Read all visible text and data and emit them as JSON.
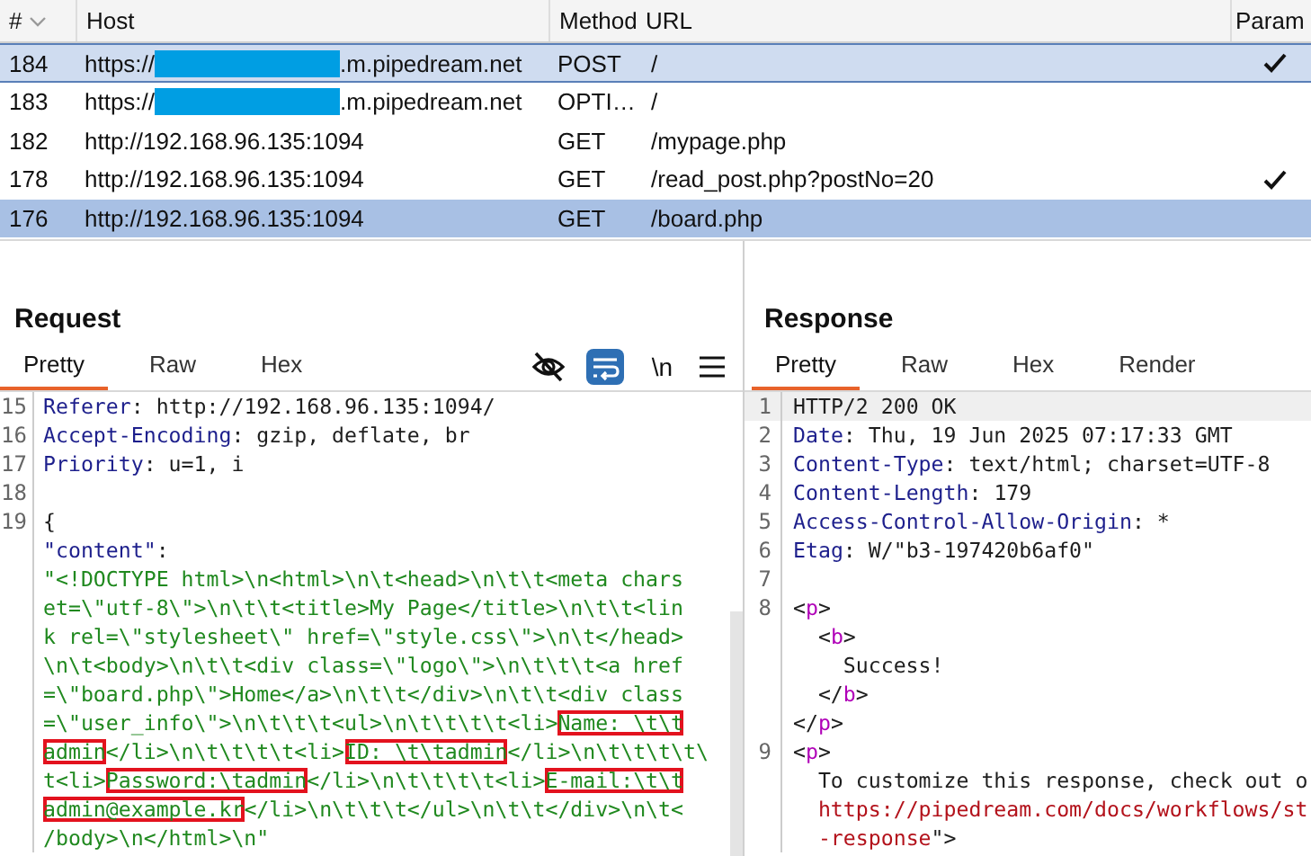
{
  "history_table": {
    "columns": [
      {
        "label": "#",
        "sorted": true
      },
      {
        "label": "Host",
        "sorted": false
      },
      {
        "label": "Method",
        "sorted": false
      },
      {
        "label": "URL",
        "sorted": false
      },
      {
        "label": "Param",
        "sorted": false
      }
    ],
    "rows": [
      {
        "number": "184",
        "host_prefix": "https://",
        "host_redacted": true,
        "host_suffix": ".m.pipedream.net",
        "method": "POST",
        "url": "/",
        "params": true,
        "highlighted": true,
        "selected": false
      },
      {
        "number": "183",
        "host_prefix": "https://",
        "host_redacted": true,
        "host_suffix": ".m.pipedream.net",
        "method": "OPTI…",
        "url": "/",
        "params": false,
        "highlighted": false,
        "selected": false
      },
      {
        "number": "182",
        "host_prefix": "http://192.168.96.135:1094",
        "host_redacted": false,
        "method": "GET",
        "url": "/mypage.php",
        "params": false,
        "highlighted": false,
        "selected": false
      },
      {
        "number": "178",
        "host_prefix": "http://192.168.96.135:1094",
        "host_redacted": false,
        "method": "GET",
        "url": "/read_post.php?postNo=20",
        "params": true,
        "highlighted": false,
        "selected": false
      },
      {
        "number": "176",
        "host_prefix": "http://192.168.96.135:1094",
        "host_redacted": false,
        "method": "GET",
        "url": "/board.php",
        "params": false,
        "highlighted": false,
        "selected": true
      }
    ]
  },
  "request": {
    "title": "Request",
    "tabs": [
      {
        "label": "Pretty",
        "selected": true
      },
      {
        "label": "Raw",
        "selected": false
      },
      {
        "label": "Hex",
        "selected": false
      }
    ],
    "toolbar": {
      "hide_non_printable": true,
      "wrap_on": true,
      "newline_label": "\\n"
    },
    "lines": [
      {
        "number": "15",
        "segments": [
          {
            "kind": "name",
            "text": "Referer"
          },
          {
            "kind": "plain",
            "text": ": http://192.168.96.135:1094/"
          }
        ]
      },
      {
        "number": "16",
        "segments": [
          {
            "kind": "name",
            "text": "Accept-Encoding"
          },
          {
            "kind": "plain",
            "text": ": gzip, deflate, br"
          }
        ]
      },
      {
        "number": "17",
        "segments": [
          {
            "kind": "name",
            "text": "Priority"
          },
          {
            "kind": "plain",
            "text": ": u=1, i"
          }
        ]
      },
      {
        "number": "18"
      },
      {
        "number": "19",
        "segments": [
          {
            "kind": "plain",
            "text": "{"
          }
        ]
      },
      {
        "segments": [
          {
            "kind": "name",
            "text": "\"content\""
          },
          {
            "kind": "plain",
            "text": ":"
          }
        ]
      },
      {
        "segments": [
          {
            "kind": "string",
            "text": "\"<!DOCTYPE html>\\n<html>\\n\\t<head>\\n\\t\\t<meta chars"
          }
        ]
      },
      {
        "segments": [
          {
            "kind": "string",
            "text": "et=\\\"utf-8\\\">\\n\\t\\t<title>My Page</title>\\n\\t\\t<lin"
          }
        ]
      },
      {
        "segments": [
          {
            "kind": "string",
            "text": "k rel=\\\"stylesheet\\\" href=\\\"style.css\\\">\\n\\t</head>"
          }
        ]
      },
      {
        "segments": [
          {
            "kind": "string",
            "text": "\\n\\t<body>\\n\\t\\t<div class=\\\"logo\\\">\\n\\t\\t\\t<a href"
          }
        ]
      },
      {
        "segments": [
          {
            "kind": "string",
            "text": "=\\\"board.php\\\">Home</a>\\n\\t\\t</div>\\n\\t\\t<div class"
          }
        ]
      },
      {
        "segments": [
          {
            "kind": "string",
            "text": "=\\\"user_info\\\">\\n\\t\\t\\t<ul>\\n\\t\\t\\t\\t<li>",
            "boxed": false
          },
          {
            "kind": "string",
            "text": "Name: \\t\\t",
            "boxed": true
          }
        ]
      },
      {
        "segments": [
          {
            "kind": "string",
            "text": "admin",
            "boxed": true
          },
          {
            "kind": "string",
            "text": "</li>\\n\\t\\t\\t\\t<li>",
            "boxed": false
          },
          {
            "kind": "string",
            "text": "ID: \\t\\tadmin",
            "boxed": true
          },
          {
            "kind": "string",
            "text": "</li>\\n\\t\\t\\t\\t\\",
            "boxed": false
          }
        ]
      },
      {
        "segments": [
          {
            "kind": "string",
            "text": "t<li>",
            "boxed": false
          },
          {
            "kind": "string",
            "text": "Password:\\tadmin",
            "boxed": true
          },
          {
            "kind": "string",
            "text": "</li>\\n\\t\\t\\t\\t<li>",
            "boxed": false
          },
          {
            "kind": "string",
            "text": "E-mail:\\t\\t",
            "boxed": true
          }
        ]
      },
      {
        "segments": [
          {
            "kind": "string",
            "text": "admin@example.kr",
            "boxed": true
          },
          {
            "kind": "string",
            "text": "</li>\\n\\t\\t\\t</ul>\\n\\t\\t</div>\\n\\t<",
            "boxed": false
          }
        ]
      },
      {
        "segments": [
          {
            "kind": "string",
            "text": "/body>\\n</html>\\n\""
          }
        ]
      }
    ]
  },
  "response": {
    "title": "Response",
    "tabs": [
      {
        "label": "Pretty",
        "selected": true
      },
      {
        "label": "Raw",
        "selected": false
      },
      {
        "label": "Hex",
        "selected": false
      },
      {
        "label": "Render",
        "selected": false
      }
    ],
    "lines": [
      {
        "number": "1",
        "kind": "top",
        "current": true,
        "segments": [
          {
            "kind": "plain",
            "text": "HTTP/2 200 OK"
          }
        ]
      },
      {
        "number": "2",
        "kind": "top",
        "current": false,
        "segments": [
          {
            "kind": "name",
            "text": "Date"
          },
          {
            "kind": "plain",
            "text": ": Thu, 19 Jun 2025 07:17:33 GMT"
          }
        ]
      },
      {
        "number": "3",
        "kind": "top",
        "current": false,
        "segments": [
          {
            "kind": "name",
            "text": "Content-Type"
          },
          {
            "kind": "plain",
            "text": ": text/html; charset=UTF-8"
          }
        ]
      },
      {
        "number": "4",
        "kind": "top",
        "current": false,
        "segments": [
          {
            "kind": "name",
            "text": "Content-Length"
          },
          {
            "kind": "plain",
            "text": ": 179"
          }
        ]
      },
      {
        "number": "5",
        "kind": "top",
        "current": false,
        "segments": [
          {
            "kind": "name",
            "text": "Access-Control-Allow-Origin"
          },
          {
            "kind": "plain",
            "text": ": *"
          }
        ]
      },
      {
        "number": "6",
        "kind": "top",
        "current": false,
        "segments": [
          {
            "kind": "name",
            "text": "Etag"
          },
          {
            "kind": "plain",
            "text": ": W/\"b3-197420b6af0\""
          }
        ]
      },
      {
        "number": "7",
        "kind": "top",
        "current": false
      },
      {
        "number": "8",
        "kind": "top",
        "current": false,
        "segments": [
          {
            "kind": "plain",
            "text": "<"
          },
          {
            "kind": "tag",
            "text": "p"
          },
          {
            "kind": "plain",
            "text": ">"
          }
        ]
      },
      {
        "kind": "inner",
        "current": false,
        "segments": [
          {
            "kind": "plain",
            "text": "<"
          },
          {
            "kind": "tag",
            "text": "b"
          },
          {
            "kind": "plain",
            "text": ">"
          }
        ]
      },
      {
        "kind": "deep",
        "current": false,
        "segments": [
          {
            "kind": "plain",
            "text": "Success!"
          }
        ]
      },
      {
        "kind": "inner",
        "current": false,
        "segments": [
          {
            "kind": "plain",
            "text": "</"
          },
          {
            "kind": "tag",
            "text": "b"
          },
          {
            "kind": "plain",
            "text": ">"
          }
        ]
      },
      {
        "kind": "top",
        "current": false,
        "segments": [
          {
            "kind": "plain",
            "text": "</"
          },
          {
            "kind": "tag",
            "text": "p"
          },
          {
            "kind": "plain",
            "text": ">"
          }
        ]
      },
      {
        "number": "9",
        "kind": "top",
        "current": false,
        "segments": [
          {
            "kind": "plain",
            "text": "<"
          },
          {
            "kind": "tag",
            "text": "p"
          },
          {
            "kind": "plain",
            "text": ">"
          }
        ]
      },
      {
        "kind": "inner",
        "current": false,
        "segments": [
          {
            "kind": "plain",
            "text": "To customize this response, check out o"
          }
        ]
      },
      {
        "kind": "inner",
        "current": false,
        "segments": [
          {
            "kind": "link",
            "text": "https://pipedream.com/docs/workflows/st"
          }
        ]
      },
      {
        "kind": "inner",
        "current": false,
        "segments": [
          {
            "kind": "link",
            "text": "-response"
          },
          {
            "kind": "plain",
            "text": "\">"
          }
        ]
      }
    ]
  }
}
